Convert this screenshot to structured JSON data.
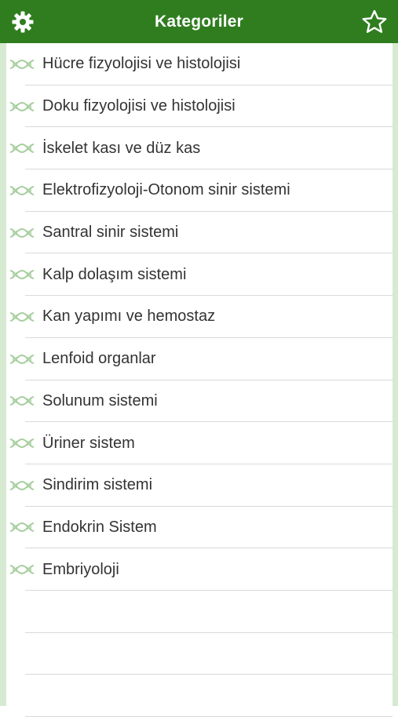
{
  "colors": {
    "header_bg": "#2f7d1f",
    "side_bg": "#d6ead1",
    "icon_tint": "#a8cfa0",
    "text": "#333333"
  },
  "header": {
    "title": "Kategoriler",
    "left_icon": "gear-icon",
    "right_icon": "star-outline-icon"
  },
  "list": {
    "item_icon": "dna-helix-icon",
    "items": [
      {
        "label": "Hücre fizyolojisi ve histolojisi"
      },
      {
        "label": "Doku fizyolojisi ve histolojisi"
      },
      {
        "label": "İskelet kası ve düz kas"
      },
      {
        "label": "Elektrofizyoloji-Otonom sinir sistemi"
      },
      {
        "label": "Santral sinir sistemi"
      },
      {
        "label": "Kalp dolaşım sistemi"
      },
      {
        "label": "Kan yapımı ve hemostaz"
      },
      {
        "label": "Lenfoid organlar"
      },
      {
        "label": "Solunum sistemi"
      },
      {
        "label": "Üriner sistem"
      },
      {
        "label": "Sindirim sistemi"
      },
      {
        "label": "Endokrin Sistem"
      },
      {
        "label": "Embriyoloji"
      }
    ]
  }
}
